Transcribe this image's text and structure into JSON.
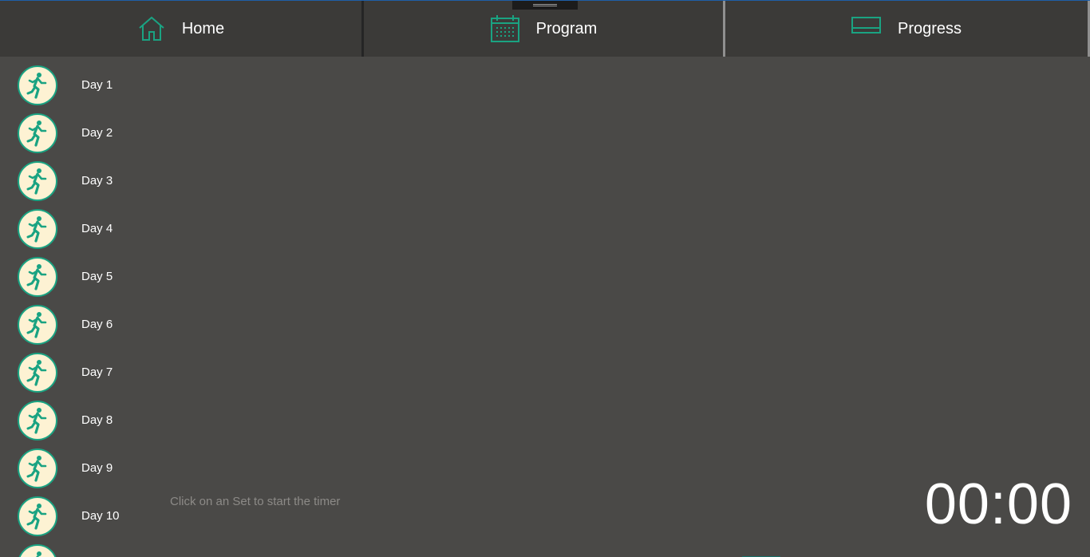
{
  "nav": {
    "tabs": [
      {
        "label": "Home",
        "icon": "home-icon"
      },
      {
        "label": "Program",
        "icon": "calendar-icon"
      },
      {
        "label": "Progress",
        "icon": "progress-icon"
      }
    ]
  },
  "days": [
    {
      "label": "Day 1"
    },
    {
      "label": "Day 2"
    },
    {
      "label": "Day 3"
    },
    {
      "label": "Day 4"
    },
    {
      "label": "Day 5"
    },
    {
      "label": "Day 6"
    },
    {
      "label": "Day 7"
    },
    {
      "label": "Day 8"
    },
    {
      "label": "Day 9"
    },
    {
      "label": "Day 10"
    },
    {
      "label": ""
    }
  ],
  "hint": "Click on an Set to start the timer",
  "timer": "00:00",
  "colors": {
    "accent": "#1aa382",
    "background": "#4a4947",
    "nav_background": "#3b3a38",
    "avatar_fill": "#fdf2d3"
  }
}
